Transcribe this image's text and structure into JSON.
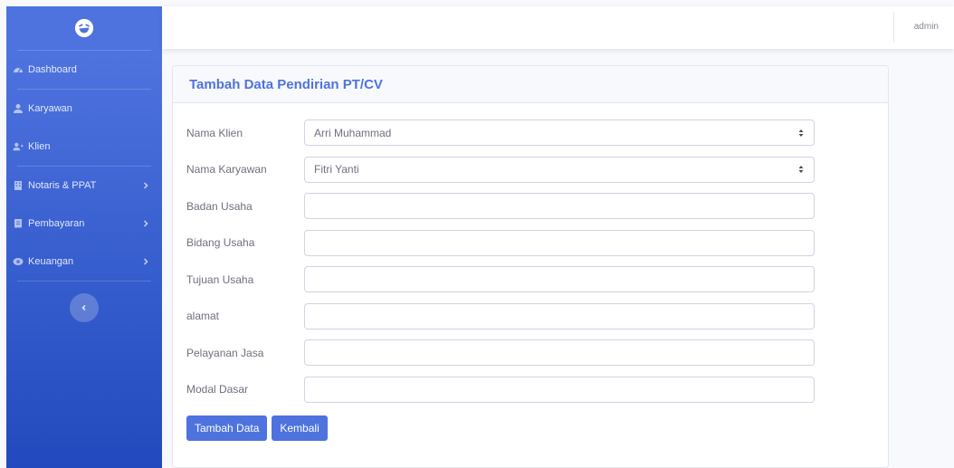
{
  "sidebar": {
    "brand_icon": "laughing-face-icon",
    "items": [
      {
        "label": "Dashboard",
        "icon": "tachometer-icon",
        "has_chevron": false
      },
      {
        "label": "Karyawan",
        "icon": "user-icon",
        "has_chevron": false
      },
      {
        "label": "Klien",
        "icon": "user-plus-icon",
        "has_chevron": false
      },
      {
        "label": "Notaris & PPAT",
        "icon": "building-icon",
        "has_chevron": true
      },
      {
        "label": "Pembayaran",
        "icon": "receipt-icon",
        "has_chevron": true
      },
      {
        "label": "Keuangan",
        "icon": "money-bill-icon",
        "has_chevron": true
      }
    ]
  },
  "topbar": {
    "user_name": "admin"
  },
  "form": {
    "title": "Tambah Data Pendirian PT/CV",
    "fields": {
      "nama_klien": {
        "label": "Nama Klien",
        "value": "Arri Muhammad"
      },
      "nama_karyawan": {
        "label": "Nama Karyawan",
        "value": "Fitri Yanti"
      },
      "badan_usaha": {
        "label": "Badan Usaha",
        "value": ""
      },
      "bidang_usaha": {
        "label": "Bidang Usaha",
        "value": ""
      },
      "tujuan_usaha": {
        "label": "Tujuan Usaha",
        "value": ""
      },
      "alamat": {
        "label": "alamat",
        "value": ""
      },
      "pelayanan_jasa": {
        "label": "Pelayanan Jasa",
        "value": ""
      },
      "modal_dasar": {
        "label": "Modal Dasar",
        "value": ""
      }
    },
    "submit_label": "Tambah Data",
    "back_label": "Kembali"
  },
  "colors": {
    "primary": "#4e73df",
    "primary_dark": "#224abe",
    "muted_text": "#6e707e",
    "background": "#f8f9fc"
  }
}
